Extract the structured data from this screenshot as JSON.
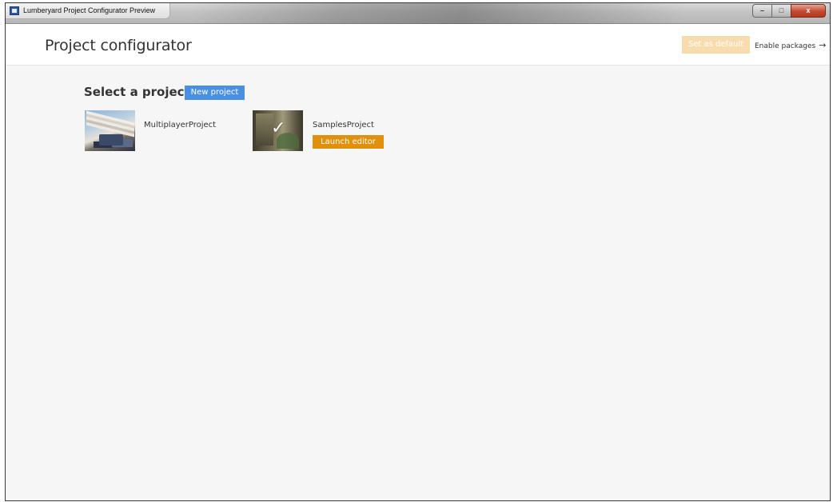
{
  "window": {
    "title": "Lumberyard Project Configurator Preview",
    "controls": {
      "minimize": "–",
      "maximize": "□",
      "close": "x"
    }
  },
  "header": {
    "title": "Project configurator",
    "set_default_label": "Set as default",
    "enable_packages_label": "Enable packages",
    "enable_packages_arrow": "→"
  },
  "main": {
    "section_title": "Select a project",
    "new_project_label": "New project",
    "projects": [
      {
        "name": "MultiplayerProject",
        "selected": false
      },
      {
        "name": "SamplesProject",
        "selected": true,
        "check_glyph": "✓",
        "launch_label": "Launch editor"
      }
    ]
  },
  "colors": {
    "accent_blue": "#4a90e2",
    "launch_orange": "#e0900c",
    "set_default_disabled": "#f9dcae",
    "background": "#f6f6f6"
  },
  "icons": {
    "app": "app-icon",
    "check": "checkmark-icon",
    "arrow": "arrow-right-icon"
  }
}
